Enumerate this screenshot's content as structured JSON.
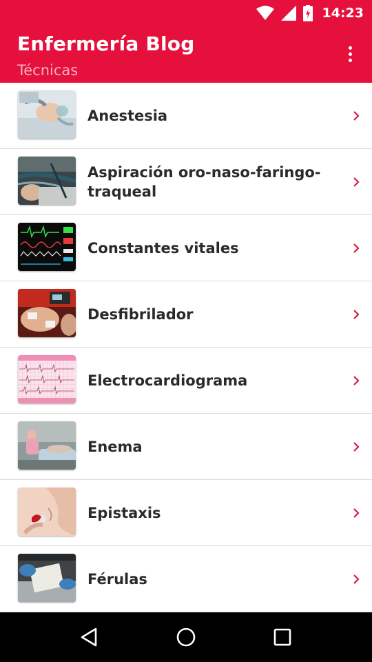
{
  "status_bar": {
    "time": "14:23",
    "icons": [
      "wifi-icon",
      "cell-signal-icon",
      "battery-charging-icon"
    ]
  },
  "app_bar": {
    "title": "Enfermería Blog",
    "subtitle": "Técnicas",
    "menu_icon": "more-vert-icon"
  },
  "colors": {
    "primary": "#e5103c",
    "subtitle": "#f6b3c1",
    "chevron": "#d81b41",
    "text": "#2a2a2a",
    "divider": "#dcdcdc"
  },
  "items": [
    {
      "label": "Anestesia",
      "image": "anesthesia-photo"
    },
    {
      "label": "Aspiración oro-naso-faringo-traqueal",
      "image": "aspiration-photo"
    },
    {
      "label": "Constantes vitales",
      "image": "vital-signs-monitor-photo"
    },
    {
      "label": "Desfibrilador",
      "image": "defibrillator-photo"
    },
    {
      "label": "Electrocardiograma",
      "image": "ecg-paper-photo"
    },
    {
      "label": "Enema",
      "image": "enema-photo"
    },
    {
      "label": "Epistaxis",
      "image": "epistaxis-photo"
    },
    {
      "label": "Férulas",
      "image": "splint-photo"
    }
  ],
  "nav_bar": {
    "buttons": [
      "back-icon",
      "home-icon",
      "recents-icon"
    ]
  }
}
